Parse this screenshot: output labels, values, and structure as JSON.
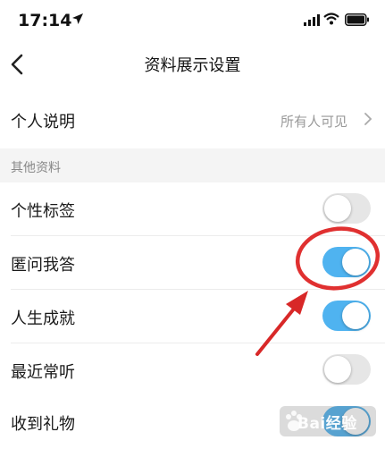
{
  "status_bar": {
    "time": "17:14",
    "icons": [
      "location-icon",
      "signal-icon",
      "wifi-icon",
      "battery-icon"
    ]
  },
  "nav": {
    "title": "资料展示设置",
    "back_icon": "chevron-left-icon"
  },
  "personal_intro": {
    "label": "个人说明",
    "value": "所有人可见"
  },
  "section": {
    "title": "其他资料"
  },
  "rows": [
    {
      "label": "个性标签",
      "enabled": false
    },
    {
      "label": "匿问我答",
      "enabled": true
    },
    {
      "label": "人生成就",
      "enabled": true
    },
    {
      "label": "最近常听",
      "enabled": false
    },
    {
      "label": "收到礼物",
      "enabled": true
    }
  ],
  "watermark": {
    "text": "Bai经验"
  },
  "colors": {
    "toggle_on": "#4fb3f0",
    "toggle_off": "#e6e6e6",
    "annotation": "#e03030",
    "section_bg": "#f4f4f4"
  }
}
